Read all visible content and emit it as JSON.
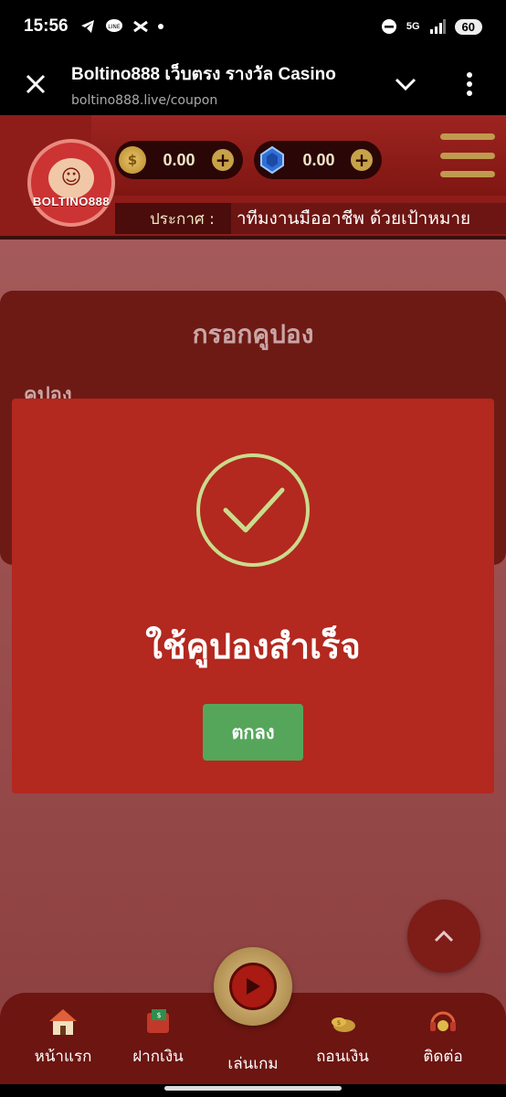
{
  "status_bar": {
    "time": "15:56",
    "network": "5G",
    "battery": "60"
  },
  "browser": {
    "title": "Boltino888 เว็บตรง รางวัล Casino",
    "url": "boltino888.live/coupon"
  },
  "header": {
    "logo_text": "BOLTINO888",
    "coin_balance": "0.00",
    "gem_balance": "0.00",
    "notice_label": "ประกาศ :",
    "notice_text": "าทีมงานมืออาชีพ ด้วยเป้าหมาย"
  },
  "coupon_page": {
    "heading": "กรอกคูปอง",
    "field_label": "คูปอง"
  },
  "modal": {
    "title": "ใช้คูปองสำเร็จ",
    "ok_label": "ตกลง",
    "check_color": "#c9dc8c"
  },
  "bottom_nav": [
    {
      "label": "หน้าแรก",
      "icon": "home-icon"
    },
    {
      "label": "ฝากเงิน",
      "icon": "deposit-icon"
    },
    {
      "label": "เล่นเกม",
      "icon": "play-icon"
    },
    {
      "label": "ถอนเงิน",
      "icon": "withdraw-icon"
    },
    {
      "label": "ติดต่อ",
      "icon": "contact-icon"
    }
  ],
  "colors": {
    "modal_bg": "#b3281f",
    "ok_button": "#55a65a",
    "header_bg": "#8e1c18",
    "nav_bg": "#6c1511"
  }
}
